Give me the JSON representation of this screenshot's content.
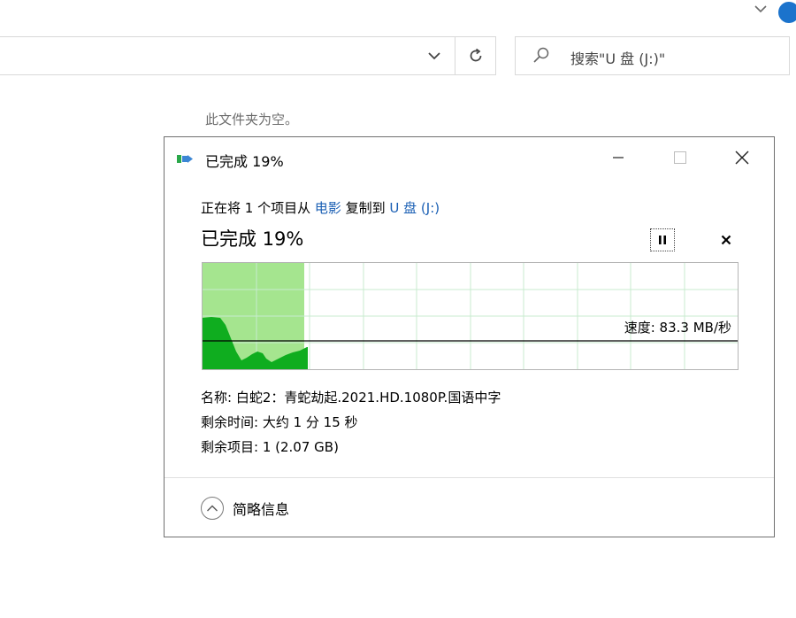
{
  "explorer": {
    "search_placeholder": "搜索\"U 盘 (J:)\"",
    "empty_message": "此文件夹为空。"
  },
  "dialog": {
    "title": "已完成 19%",
    "copy_prefix": "正在将 1 个项目从 ",
    "copy_source": "电影",
    "copy_middle": " 复制到 ",
    "copy_dest": "U 盘 (J:)",
    "progress_text": "已完成 19%",
    "progress_percent": 19,
    "speed_label": "速度: 83.3 MB/秒",
    "name_line": "名称: 白蛇2：青蛇劫起.2021.HD.1080P.国语中字",
    "time_remaining_line": "剩余时间: 大约 1 分 15 秒",
    "items_remaining_line": "剩余项目: 1 (2.07 GB)",
    "details_toggle_label": "简略信息"
  },
  "colors": {
    "graph_progress_fill": "#a5e58f",
    "graph_speed_fill": "#0fad1f",
    "graph_grid": "#c8ebcf",
    "link": "#1a5fb4",
    "accent": "#1b73cc"
  }
}
